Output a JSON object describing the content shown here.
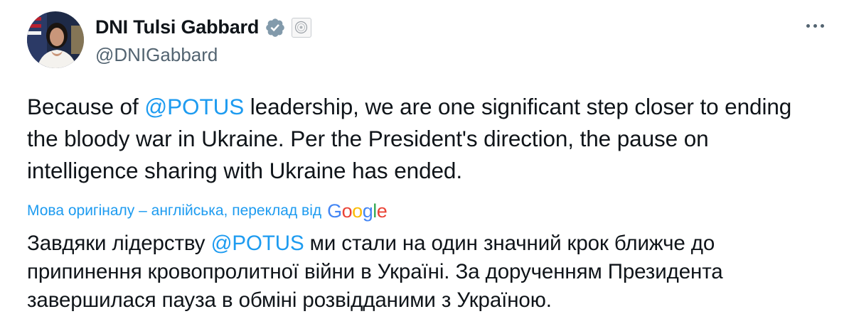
{
  "author": {
    "display_name": "DNI Tulsi Gabbard",
    "handle": "@DNIGabbard",
    "verified_badge_color": "#829aab"
  },
  "tweet": {
    "text_part1": "Because of ",
    "mention": "@POTUS",
    "text_part2": " leadership, we are one significant step closer to ending the bloody war in Ukraine. Per the President's direction, the pause on intelligence sharing with Ukraine has ended."
  },
  "translation": {
    "notice": "Мова оригіналу – англійська, переклад від",
    "provider_letters": [
      "G",
      "o",
      "o",
      "g",
      "l",
      "e"
    ],
    "text_part1": "Завдяки лідерству ",
    "mention": "@POTUS",
    "text_part2": " ми стали на один значний крок ближче до припинення кровопролитної війни в Україні. За дорученням Президента завершилася пауза в обміні розвідданими з Україною."
  },
  "colors": {
    "link": "#1d9bf0",
    "text": "#0f1419",
    "secondary": "#536471"
  }
}
